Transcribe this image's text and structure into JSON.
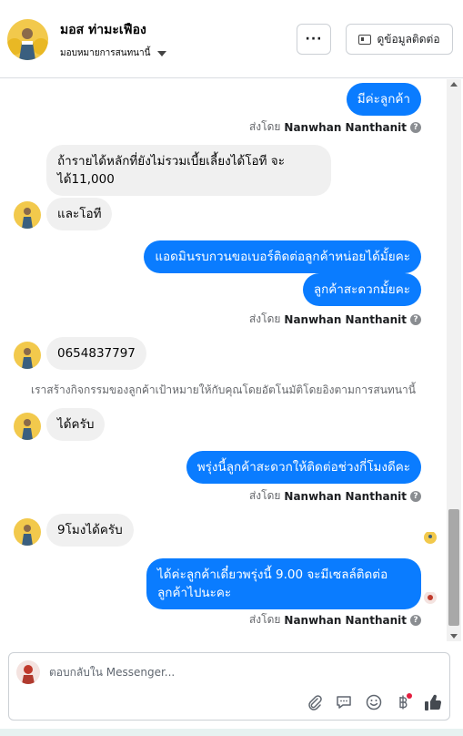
{
  "header": {
    "contact_name": "มอส ท่ามะเฟือง",
    "assign_label": "มอบหมายการสนทนานี้",
    "more_label": "···",
    "contact_info_label": "ดูข้อมูลติดต่อ"
  },
  "messages": {
    "m1": "มีค่ะลูกค้า",
    "m2": "ถ้ารายได้หลักที่ยังไม่รวมเบี้ยเลี้ยงได้โอที จะได้11,000",
    "m3": "และโอที",
    "m4": "แอดมินรบกวนขอเบอร์ติดต่อลูกค้าหน่อยได้มั้ยคะ",
    "m5": "ลูกค้าสะดวกมั้ยคะ",
    "m6": "0654837797",
    "m7": "ได้ครับ",
    "m8": "พรุ่งนี้ลูกค้าสะดวกให้ติดต่อช่วงกี่โมงดีคะ",
    "m9": "9โมงได้ครับ",
    "m10": "ได้ค่ะลูกค้าเดี๋ยวพรุ่งนี้ 9.00 จะมีเซลล์ติดต่อลูกค้าไปนะคะ"
  },
  "sent_by": {
    "prefix": "ส่งโดย",
    "agent": "Nanwhan Nanthanit",
    "info_icon": "question-icon"
  },
  "notice_text": "เราสร้างกิจกรรมของลูกค้าเป้าหมายให้กับคุณโดยอัตโนมัติโดยอิงตามการสนทนานี้",
  "composer": {
    "placeholder": "ตอบกลับใน Messenger..."
  },
  "icons": {
    "attach": "paperclip-icon",
    "saved_replies": "chat-bubble-icon",
    "emoji": "smiley-icon",
    "payment": "baht-icon",
    "like": "thumbs-up-icon"
  },
  "colors": {
    "outgoing_bubble": "#0a7cff",
    "incoming_bubble": "#f0f0f0",
    "notification_dot": "#e41e3f"
  }
}
